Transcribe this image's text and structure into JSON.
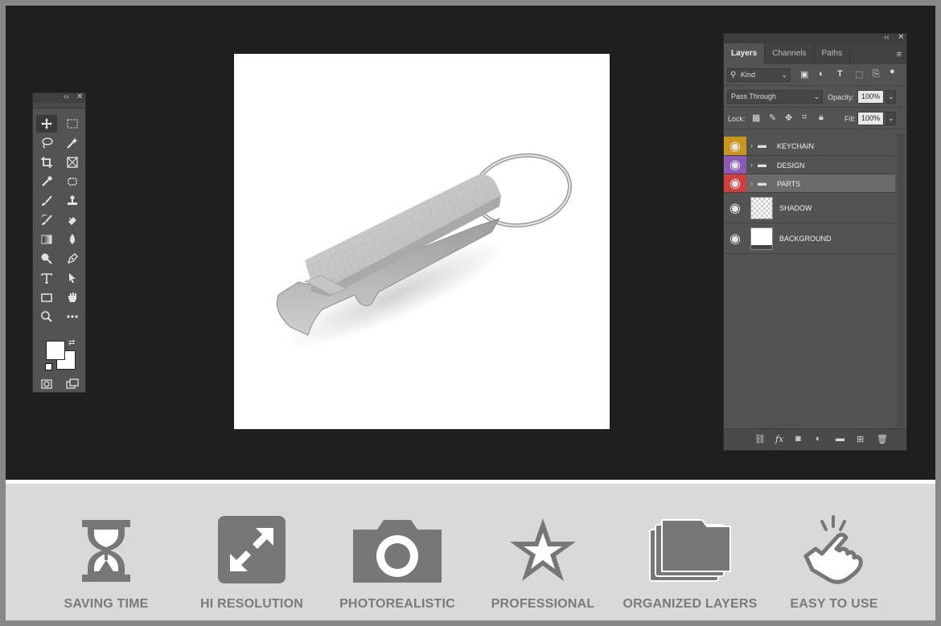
{
  "tools_panel": {
    "collapse_label": "‹‹",
    "close_label": "✕"
  },
  "layers_panel": {
    "collapse_label": "‹‹",
    "close_label": "✕",
    "tabs": [
      {
        "label": "Layers"
      },
      {
        "label": "Channels"
      },
      {
        "label": "Paths"
      }
    ],
    "filter_kind": "Kind",
    "blend_mode": "Pass Through",
    "opacity_label": "Opacity:",
    "opacity_value": "100%",
    "lock_label": "Lock:",
    "fill_label": "Fill:",
    "fill_value": "100%",
    "layers": [
      {
        "name": "KEYCHAIN",
        "color": "#c8961a",
        "type": "group"
      },
      {
        "name": "DESIGN",
        "color": "#8a5ab4",
        "type": "group"
      },
      {
        "name": "PARTS",
        "color": "#cf3f3f",
        "type": "group"
      },
      {
        "name": "SHADOW",
        "color": "",
        "type": "layer"
      },
      {
        "name": "BACKGROUND",
        "color": "",
        "type": "layer"
      }
    ]
  },
  "features": [
    {
      "label": "SAVING TIME",
      "icon": "hourglass-icon"
    },
    {
      "label": "HI RESOLUTION",
      "icon": "expand-icon"
    },
    {
      "label": "PHOTOREALISTIC",
      "icon": "camera-icon"
    },
    {
      "label": "PROFESSIONAL",
      "icon": "star-icon"
    },
    {
      "label": "ORGANIZED LAYERS",
      "icon": "folders-icon"
    },
    {
      "label": "EASY TO USE",
      "icon": "hand-click-icon"
    }
  ],
  "colors": {
    "workspace": "#1f1f1f",
    "panel": "#535353",
    "feature_icon": "#777777",
    "feature_text": "#7a7a7a"
  }
}
